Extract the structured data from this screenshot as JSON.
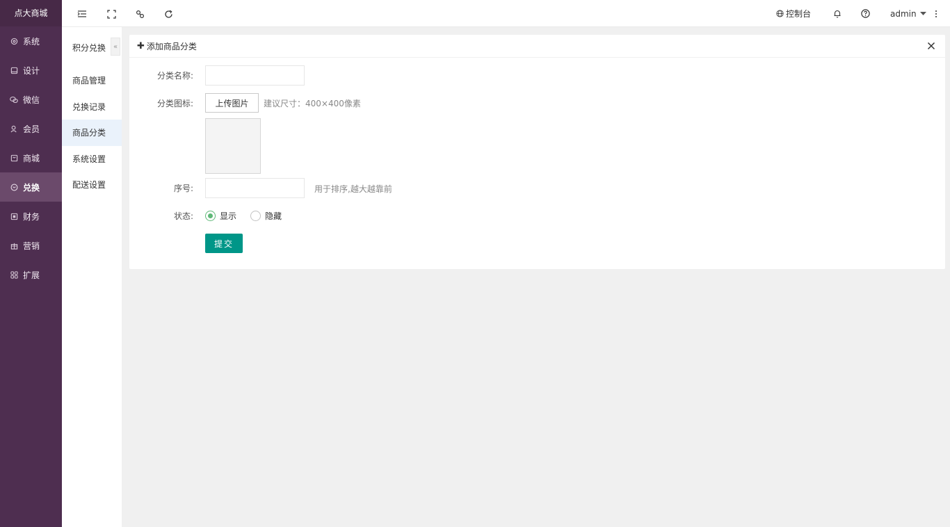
{
  "app": {
    "logo": "点大商城"
  },
  "sidebar": {
    "items": [
      {
        "label": "系统",
        "icon": "gear-icon"
      },
      {
        "label": "设计",
        "icon": "monitor-icon"
      },
      {
        "label": "微信",
        "icon": "wechat-icon"
      },
      {
        "label": "会员",
        "icon": "user-icon"
      },
      {
        "label": "商城",
        "icon": "shop-icon"
      },
      {
        "label": "兑换",
        "icon": "exchange-icon",
        "active": true
      },
      {
        "label": "财务",
        "icon": "finance-icon"
      },
      {
        "label": "营销",
        "icon": "gift-icon"
      },
      {
        "label": "扩展",
        "icon": "grid-icon"
      }
    ]
  },
  "subnav": {
    "title": "积分兑换",
    "collapse_glyph": "«",
    "items": [
      {
        "label": "商品管理"
      },
      {
        "label": "兑换记录"
      },
      {
        "label": "商品分类",
        "active": true
      },
      {
        "label": "系统设置"
      },
      {
        "label": "配送设置"
      }
    ]
  },
  "topbar": {
    "console_label": "控制台",
    "user_label": "admin"
  },
  "card": {
    "title": "添加商品分类",
    "plus_glyph": "✚",
    "form": {
      "name_label": "分类名称:",
      "name_value": "",
      "icon_label": "分类图标:",
      "upload_label": "上传图片",
      "icon_hint": "建议尺寸：400×400像素",
      "sort_label": "序号:",
      "sort_value": "",
      "sort_hint": "用于排序,越大越靠前",
      "status_label": "状态:",
      "status_options": [
        {
          "label": "显示",
          "checked": true
        },
        {
          "label": "隐藏",
          "checked": false
        }
      ],
      "submit_label": "提交"
    }
  },
  "colors": {
    "sidebar_bg": "#4e2e50",
    "sidebar_active": "#6b4a6b",
    "primary_button": "#009688",
    "radio_checked": "#5fb878"
  }
}
